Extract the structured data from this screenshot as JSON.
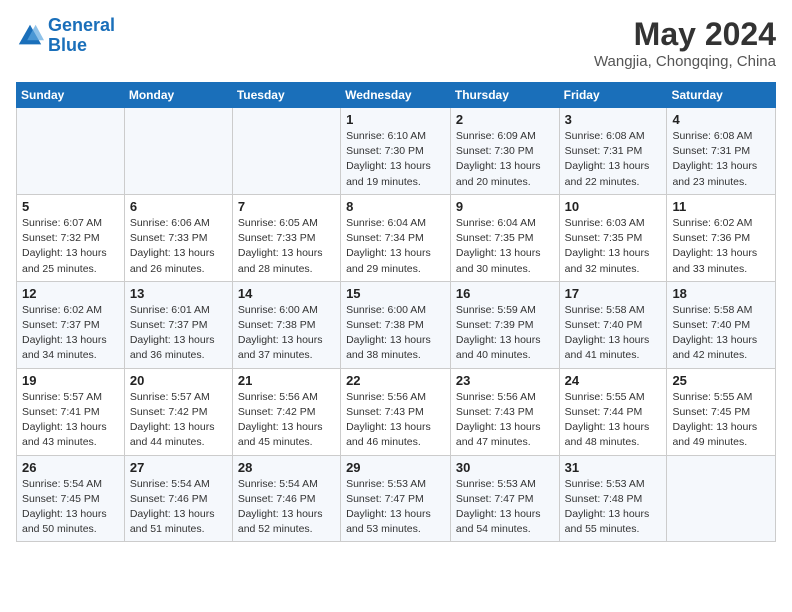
{
  "header": {
    "logo_line1": "General",
    "logo_line2": "Blue",
    "month_year": "May 2024",
    "location": "Wangjia, Chongqing, China"
  },
  "weekdays": [
    "Sunday",
    "Monday",
    "Tuesday",
    "Wednesday",
    "Thursday",
    "Friday",
    "Saturday"
  ],
  "weeks": [
    [
      {
        "day": "",
        "info": ""
      },
      {
        "day": "",
        "info": ""
      },
      {
        "day": "",
        "info": ""
      },
      {
        "day": "1",
        "info": "Sunrise: 6:10 AM\nSunset: 7:30 PM\nDaylight: 13 hours\nand 19 minutes."
      },
      {
        "day": "2",
        "info": "Sunrise: 6:09 AM\nSunset: 7:30 PM\nDaylight: 13 hours\nand 20 minutes."
      },
      {
        "day": "3",
        "info": "Sunrise: 6:08 AM\nSunset: 7:31 PM\nDaylight: 13 hours\nand 22 minutes."
      },
      {
        "day": "4",
        "info": "Sunrise: 6:08 AM\nSunset: 7:31 PM\nDaylight: 13 hours\nand 23 minutes."
      }
    ],
    [
      {
        "day": "5",
        "info": "Sunrise: 6:07 AM\nSunset: 7:32 PM\nDaylight: 13 hours\nand 25 minutes."
      },
      {
        "day": "6",
        "info": "Sunrise: 6:06 AM\nSunset: 7:33 PM\nDaylight: 13 hours\nand 26 minutes."
      },
      {
        "day": "7",
        "info": "Sunrise: 6:05 AM\nSunset: 7:33 PM\nDaylight: 13 hours\nand 28 minutes."
      },
      {
        "day": "8",
        "info": "Sunrise: 6:04 AM\nSunset: 7:34 PM\nDaylight: 13 hours\nand 29 minutes."
      },
      {
        "day": "9",
        "info": "Sunrise: 6:04 AM\nSunset: 7:35 PM\nDaylight: 13 hours\nand 30 minutes."
      },
      {
        "day": "10",
        "info": "Sunrise: 6:03 AM\nSunset: 7:35 PM\nDaylight: 13 hours\nand 32 minutes."
      },
      {
        "day": "11",
        "info": "Sunrise: 6:02 AM\nSunset: 7:36 PM\nDaylight: 13 hours\nand 33 minutes."
      }
    ],
    [
      {
        "day": "12",
        "info": "Sunrise: 6:02 AM\nSunset: 7:37 PM\nDaylight: 13 hours\nand 34 minutes."
      },
      {
        "day": "13",
        "info": "Sunrise: 6:01 AM\nSunset: 7:37 PM\nDaylight: 13 hours\nand 36 minutes."
      },
      {
        "day": "14",
        "info": "Sunrise: 6:00 AM\nSunset: 7:38 PM\nDaylight: 13 hours\nand 37 minutes."
      },
      {
        "day": "15",
        "info": "Sunrise: 6:00 AM\nSunset: 7:38 PM\nDaylight: 13 hours\nand 38 minutes."
      },
      {
        "day": "16",
        "info": "Sunrise: 5:59 AM\nSunset: 7:39 PM\nDaylight: 13 hours\nand 40 minutes."
      },
      {
        "day": "17",
        "info": "Sunrise: 5:58 AM\nSunset: 7:40 PM\nDaylight: 13 hours\nand 41 minutes."
      },
      {
        "day": "18",
        "info": "Sunrise: 5:58 AM\nSunset: 7:40 PM\nDaylight: 13 hours\nand 42 minutes."
      }
    ],
    [
      {
        "day": "19",
        "info": "Sunrise: 5:57 AM\nSunset: 7:41 PM\nDaylight: 13 hours\nand 43 minutes."
      },
      {
        "day": "20",
        "info": "Sunrise: 5:57 AM\nSunset: 7:42 PM\nDaylight: 13 hours\nand 44 minutes."
      },
      {
        "day": "21",
        "info": "Sunrise: 5:56 AM\nSunset: 7:42 PM\nDaylight: 13 hours\nand 45 minutes."
      },
      {
        "day": "22",
        "info": "Sunrise: 5:56 AM\nSunset: 7:43 PM\nDaylight: 13 hours\nand 46 minutes."
      },
      {
        "day": "23",
        "info": "Sunrise: 5:56 AM\nSunset: 7:43 PM\nDaylight: 13 hours\nand 47 minutes."
      },
      {
        "day": "24",
        "info": "Sunrise: 5:55 AM\nSunset: 7:44 PM\nDaylight: 13 hours\nand 48 minutes."
      },
      {
        "day": "25",
        "info": "Sunrise: 5:55 AM\nSunset: 7:45 PM\nDaylight: 13 hours\nand 49 minutes."
      }
    ],
    [
      {
        "day": "26",
        "info": "Sunrise: 5:54 AM\nSunset: 7:45 PM\nDaylight: 13 hours\nand 50 minutes."
      },
      {
        "day": "27",
        "info": "Sunrise: 5:54 AM\nSunset: 7:46 PM\nDaylight: 13 hours\nand 51 minutes."
      },
      {
        "day": "28",
        "info": "Sunrise: 5:54 AM\nSunset: 7:46 PM\nDaylight: 13 hours\nand 52 minutes."
      },
      {
        "day": "29",
        "info": "Sunrise: 5:53 AM\nSunset: 7:47 PM\nDaylight: 13 hours\nand 53 minutes."
      },
      {
        "day": "30",
        "info": "Sunrise: 5:53 AM\nSunset: 7:47 PM\nDaylight: 13 hours\nand 54 minutes."
      },
      {
        "day": "31",
        "info": "Sunrise: 5:53 AM\nSunset: 7:48 PM\nDaylight: 13 hours\nand 55 minutes."
      },
      {
        "day": "",
        "info": ""
      }
    ]
  ]
}
